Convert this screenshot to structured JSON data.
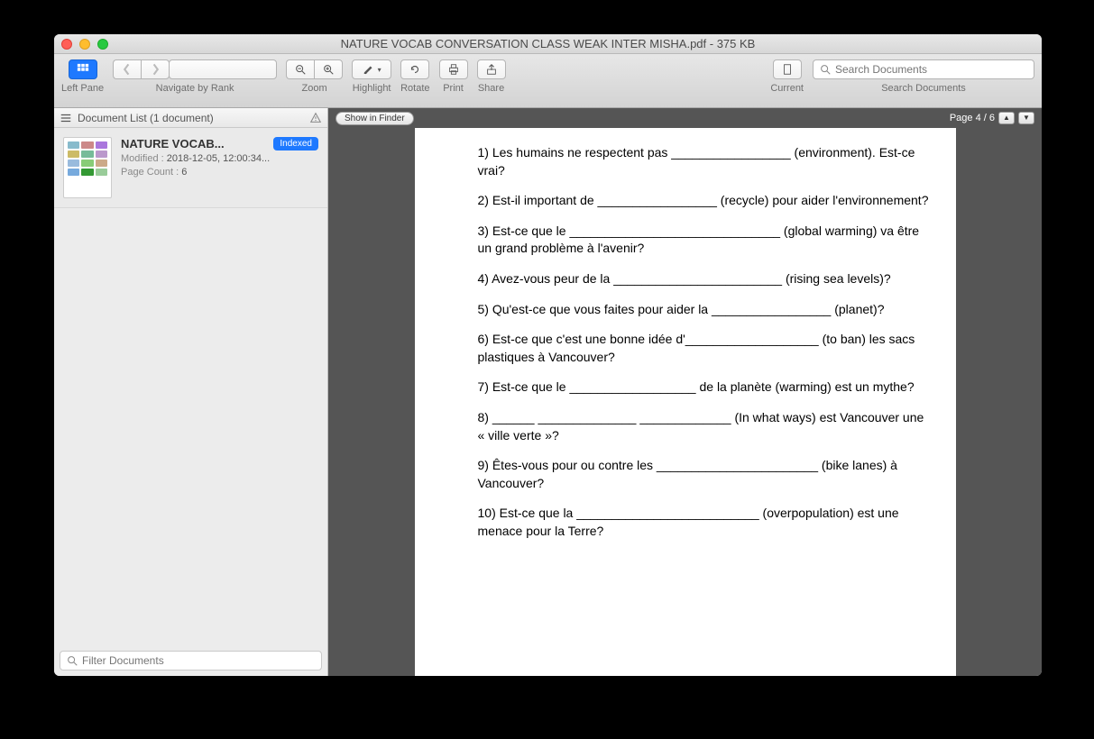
{
  "window": {
    "title": "NATURE VOCAB CONVERSATION CLASS WEAK INTER MISHA.pdf - 375 KB"
  },
  "toolbar": {
    "leftpane_label": "Left Pane",
    "navigate_label": "Navigate by Rank",
    "zoom_label": "Zoom",
    "highlight_label": "Highlight",
    "rotate_label": "Rotate",
    "print_label": "Print",
    "share_label": "Share",
    "current_label": "Current",
    "search_label": "Search Documents",
    "search_placeholder": "Search Documents"
  },
  "sidebar": {
    "header": "Document List (1 document)",
    "filter_placeholder": "Filter Documents",
    "doc": {
      "title": "NATURE VOCAB...",
      "badge": "Indexed",
      "modified_label": "Modified :",
      "modified_value": "2018-12-05, 12:00:34...",
      "pagecount_label": "Page Count :",
      "pagecount_value": "6"
    }
  },
  "content": {
    "show_in_finder": "Show in Finder",
    "page_indicator": "Page 4 / 6"
  },
  "pdf": {
    "q1": "1) Les humains ne respectent pas _________________ (environment). Est-ce vrai?",
    "q2": "2) Est-il important de _________________ (recycle) pour aider l'environnement?",
    "q3": "3) Est-ce que le ______________________________ (global warming) va être un grand problème à l'avenir?",
    "q4": "4) Avez-vous peur de la ________________________ (rising sea levels)?",
    "q5": "5) Qu'est-ce que vous faites pour aider la _________________ (planet)?",
    "q6": "6) Est-ce que c'est une bonne idée d'___________________ (to ban) les sacs plastiques à Vancouver?",
    "q7": "7) Est-ce que le __________________ de la planète (warming) est un mythe?",
    "q8": "8) ______ ______________ _____________ (In what ways) est Vancouver une « ville verte »?",
    "q9": "9) Êtes-vous pour ou contre les _______________________ (bike lanes) à Vancouver?",
    "q10": "10) Est-ce que la __________________________ (overpopulation) est une menace pour la Terre?"
  }
}
